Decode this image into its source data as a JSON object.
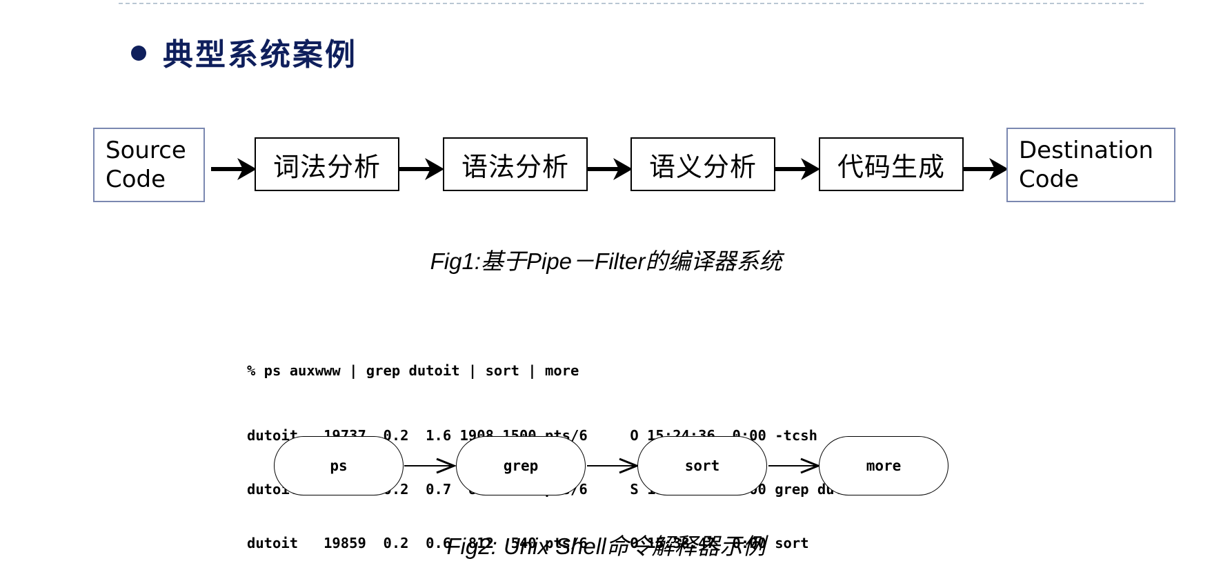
{
  "heading": "典型系统案例",
  "fig1": {
    "source_label": "Source\nCode",
    "stages": [
      "词法分析",
      "语法分析",
      "语义分析",
      "代码生成"
    ],
    "destination_label": "Destination\nCode",
    "caption": "Fig1:基于Pipe－Filter的编译器系统"
  },
  "fig2": {
    "command": "% ps auxwww | grep dutoit | sort | more",
    "rows": [
      "dutoit   19737  0.2  1.6 1908 1500 pts/6     O 15:24:36  0:00 -tcsh",
      "dutoit   19858  0.2  0.7  816  580 pts/6     S 15:38:46  0:00 grep dutoit",
      "dutoit   19859  0.2  0.6  812  540 pts/6     O 15:38:47  0:00 sort"
    ],
    "filters": [
      "ps",
      "grep",
      "sort",
      "more"
    ],
    "caption": "Fig2: Unix Shell命令解释器示例"
  }
}
